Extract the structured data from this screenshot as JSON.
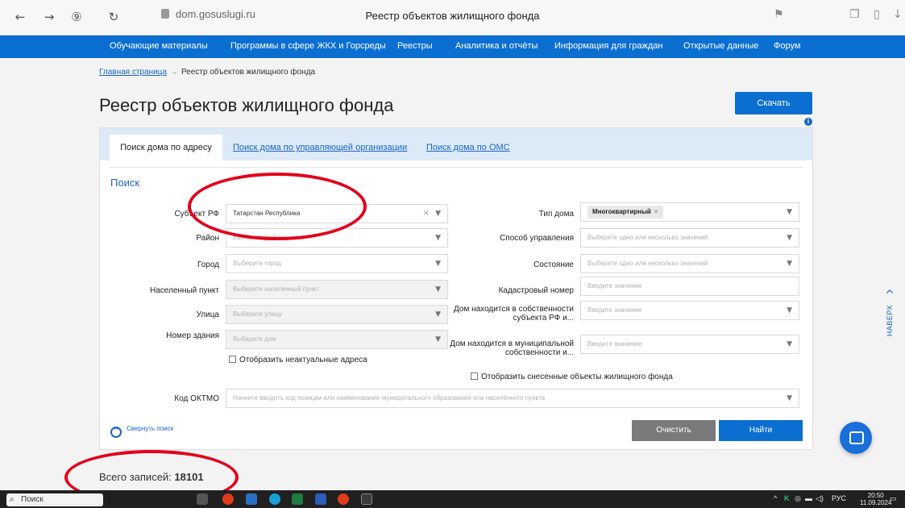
{
  "browser": {
    "url": "dom.gosuslugi.ru",
    "tab_title": "Реестр объектов жилищного фонда"
  },
  "nav": {
    "items": [
      "Обучающие материалы",
      "Программы в сфере ЖКХ и Горсреды",
      "Реестры",
      "Аналитика и отчёты",
      "Информация для граждан",
      "Открытые данные",
      "Форум"
    ]
  },
  "breadcrumb": {
    "home": "Главная страница",
    "sep": "→",
    "current": "Реестр объектов жилищного фонда"
  },
  "page": {
    "title": "Реестр объектов жилищного фонда",
    "download_label": "Скачать",
    "info_glyph": "i"
  },
  "tabs": [
    "Поиск дома по адресу",
    "Поиск дома по управляющей организации",
    "Поиск дома по ОМС"
  ],
  "search": {
    "title": "Поиск",
    "left_fields": [
      {
        "label": "Субъект РФ",
        "value": "Татарстан Республика",
        "placeholder": ""
      },
      {
        "label": "Район",
        "value": "",
        "placeholder": "Выберите район"
      },
      {
        "label": "Город",
        "value": "",
        "placeholder": "Выберите город"
      },
      {
        "label": "Населенный пункт",
        "value": "",
        "placeholder": "Выберите населенный пункт"
      },
      {
        "label": "Улица",
        "value": "",
        "placeholder": "Выберите улицу"
      },
      {
        "label": "Номер здания",
        "value": "",
        "placeholder": "Выберите дом"
      }
    ],
    "right_fields": [
      {
        "label": "Тип дома",
        "chip": "Многоквартирный",
        "placeholder": ""
      },
      {
        "label": "Способ управления",
        "value": "",
        "placeholder": "Выберите одно или несколько значений"
      },
      {
        "label": "Состояние",
        "value": "",
        "placeholder": "Выберите одно или несколько значений"
      },
      {
        "label": "Кадастровый номер",
        "value": "",
        "placeholder": "Введите значение"
      },
      {
        "label": "Дом находится в собственности субъекта РФ и...",
        "value": "",
        "placeholder": "Введите значение"
      },
      {
        "label": "Дом находится в муниципальной собственности и...",
        "value": "",
        "placeholder": "Введите значение"
      }
    ],
    "checkbox_outdated": "Отобразить неактуальные адреса",
    "checkbox_demolished": "Отобразить снесенные объекты жилищного фонда",
    "oktmo_label": "Код ОКТМО",
    "oktmo_placeholder": "Начните вводить код позиции или наименование муниципального образования или населённого пункта",
    "collapse_label": "Свернуть поиск",
    "clear_label": "Очистить",
    "find_label": "Найти"
  },
  "results": {
    "total_label": "Всего записей:",
    "total_value": "18101"
  },
  "back_to_top": "НАВЕРХ",
  "taskbar": {
    "search": "Поиск",
    "lang": "РУС",
    "time": "20:50",
    "date": "11.09.2024"
  },
  "colors": {
    "brand_blue": "#0b6fd1",
    "annotation_red": "#e3001b"
  }
}
